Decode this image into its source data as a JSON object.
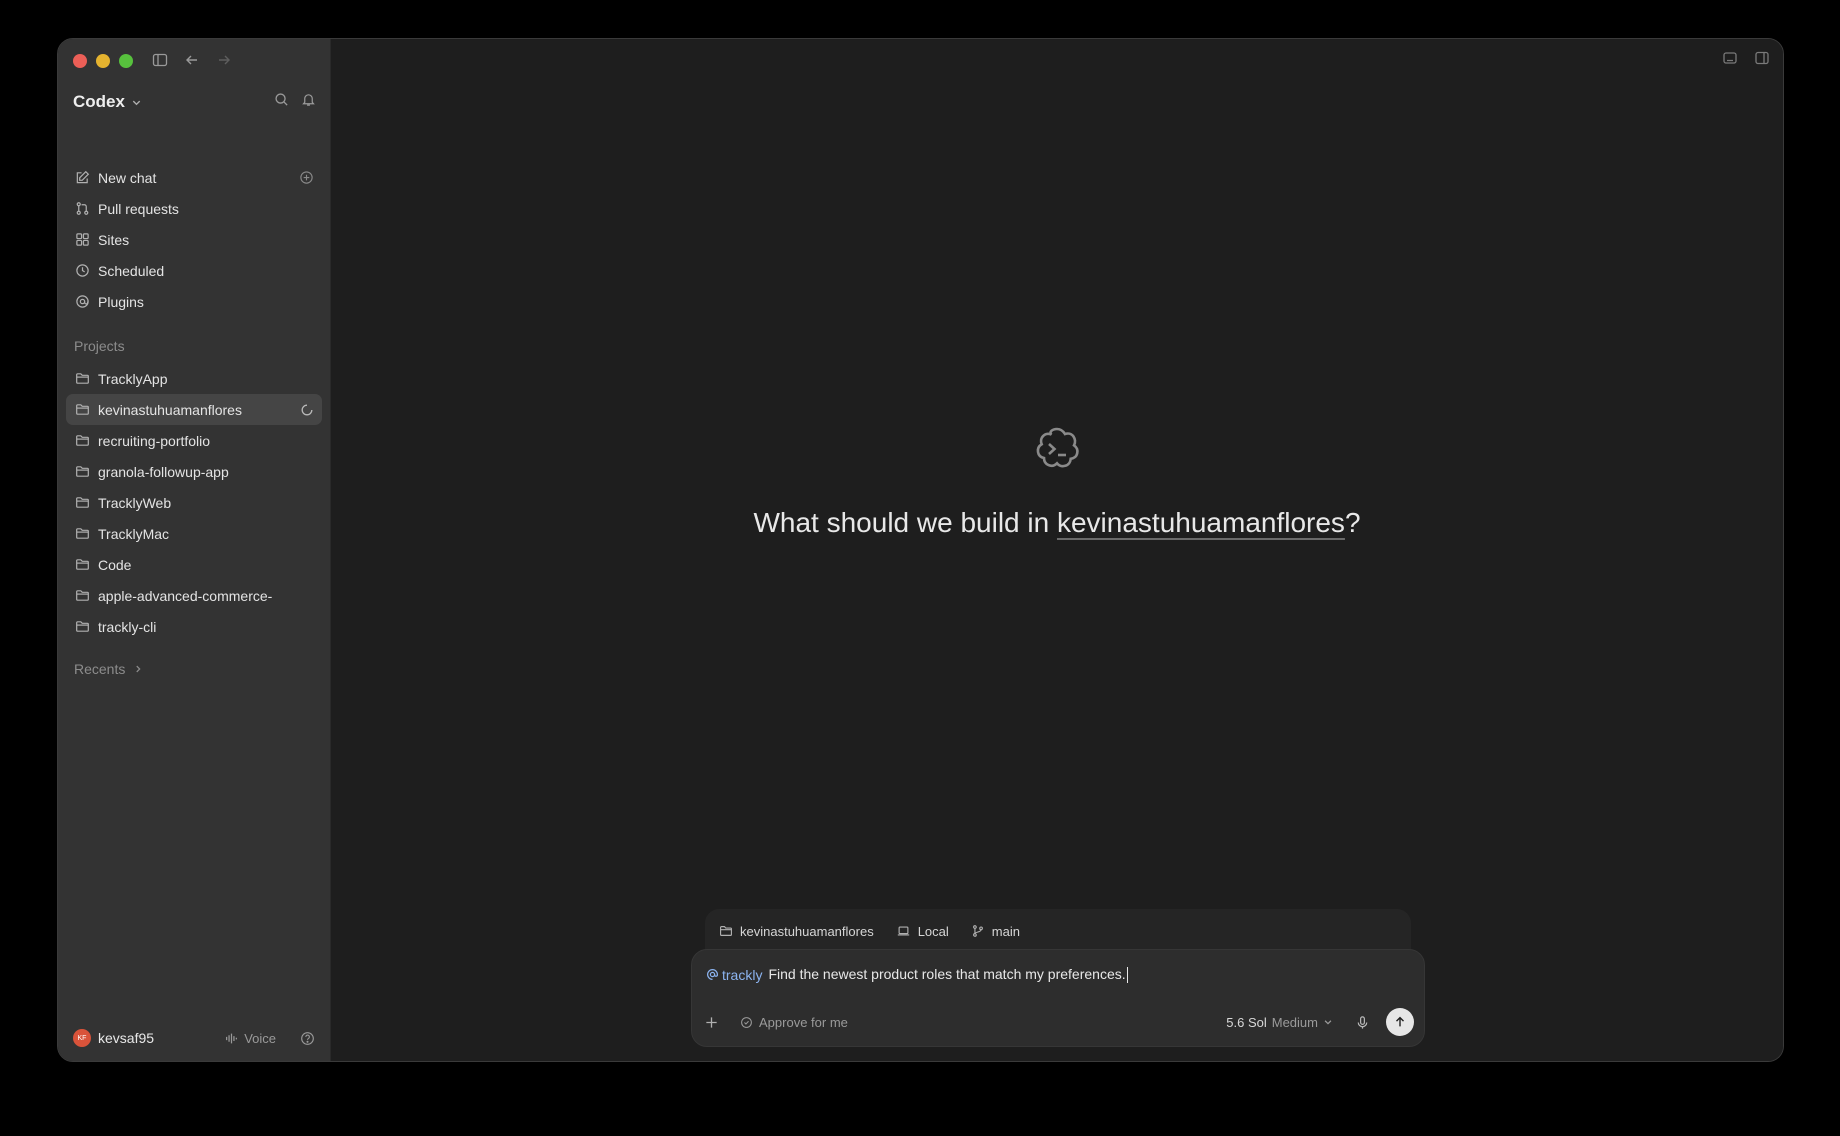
{
  "window": {
    "traffic_colors": {
      "close": "#ec5f57",
      "minimize": "#e5b32f",
      "zoom": "#57c13d"
    }
  },
  "sidebar": {
    "brand": "Codex",
    "nav": [
      {
        "label": "New chat",
        "icon": "edit-icon"
      },
      {
        "label": "Pull requests",
        "icon": "pull-request-icon"
      },
      {
        "label": "Sites",
        "icon": "grid-icon"
      },
      {
        "label": "Scheduled",
        "icon": "clock-icon"
      },
      {
        "label": "Plugins",
        "icon": "at-icon"
      }
    ],
    "projects_label": "Projects",
    "projects": [
      {
        "label": "TracklyApp"
      },
      {
        "label": "kevinastuhuamanflores",
        "active": true
      },
      {
        "label": "recruiting-portfolio"
      },
      {
        "label": "granola-followup-app"
      },
      {
        "label": "TracklyWeb"
      },
      {
        "label": "TracklyMac"
      },
      {
        "label": "Code"
      },
      {
        "label": "apple-advanced-commerce-"
      },
      {
        "label": "trackly-cli"
      }
    ],
    "recents_label": "Recents",
    "footer": {
      "avatar_initials": "KF",
      "username": "kevsaf95",
      "voice_label": "Voice"
    }
  },
  "main": {
    "hero": {
      "prefix": "What should we build in ",
      "project": "kevinastuhuamanflores",
      "suffix": "?"
    },
    "context": {
      "project": "kevinastuhuamanflores",
      "environment": "Local",
      "branch": "main"
    },
    "composer": {
      "mention": "trackly",
      "text": "Find the newest product roles that match my preferences.",
      "approval_label": "Approve for me",
      "model": "5.6 Sol",
      "effort": "Medium"
    }
  },
  "accent": {
    "mention": "#8cb4f0",
    "send_button": "#e6e6e6"
  }
}
